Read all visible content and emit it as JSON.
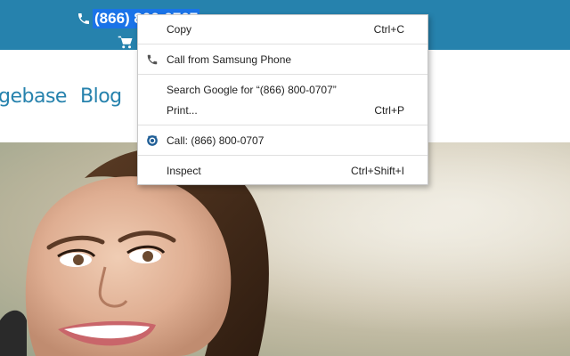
{
  "header": {
    "phone_number": "(866) 800-0707",
    "bar_color": "#2682ad",
    "icons": [
      "phone-icon",
      "cart-icon"
    ]
  },
  "nav": {
    "items": [
      {
        "label": "gebase"
      },
      {
        "label": "Blog"
      }
    ]
  },
  "context_menu": {
    "copy": {
      "label": "Copy",
      "shortcut": "Ctrl+C"
    },
    "call_samsung": {
      "label": "Call from Samsung Phone",
      "icon": "phone-handset-icon"
    },
    "search_google": {
      "label": "Search Google for “(866) 800-0707”"
    },
    "print": {
      "label": "Print...",
      "shortcut": "Ctrl+P"
    },
    "call": {
      "label": "Call: (866) 800-0707",
      "icon": "call-app-icon"
    },
    "inspect": {
      "label": "Inspect",
      "shortcut": "Ctrl+Shift+I"
    }
  }
}
